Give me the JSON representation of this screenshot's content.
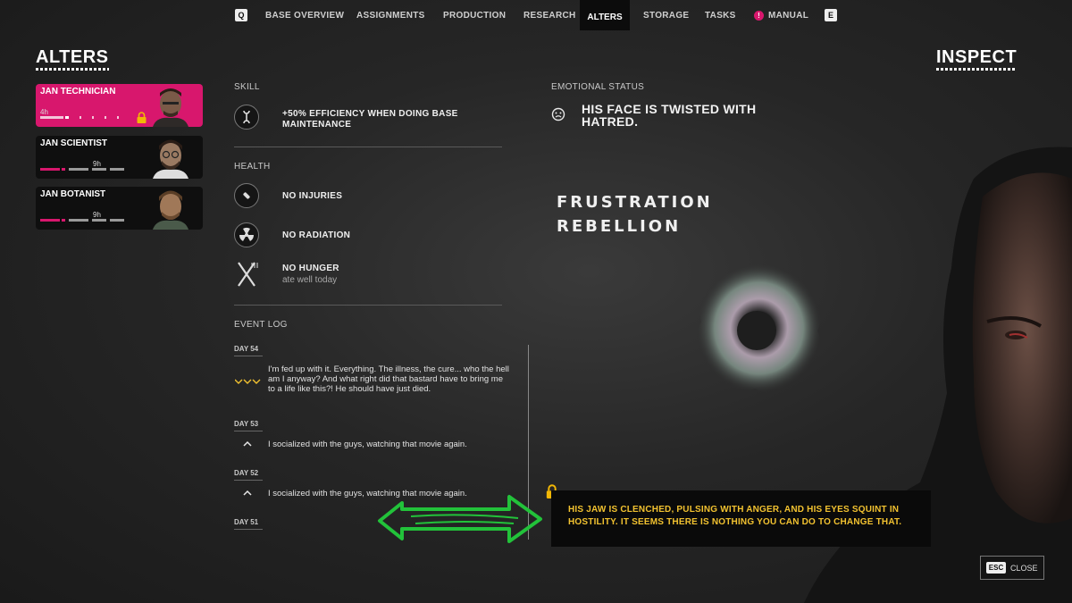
{
  "nav": {
    "key_left": "Q",
    "key_right": "E",
    "items": [
      "BASE OVERVIEW",
      "ASSIGNMENTS",
      "PRODUCTION",
      "RESEARCH",
      "ALTERS",
      "STORAGE",
      "TASKS",
      "MANUAL"
    ],
    "manual_badge": "!"
  },
  "left_title": "ALTERS",
  "right_title": "INSPECT",
  "alters": [
    {
      "name": "JAN TECHNICIAN",
      "hours": "4h",
      "selected": true,
      "locked": true
    },
    {
      "name": "JAN SCIENTIST",
      "hours": "9h",
      "selected": false
    },
    {
      "name": "JAN BOTANIST",
      "hours": "9h",
      "selected": false
    }
  ],
  "skill": {
    "label": "SKILL",
    "text": "+50% EFFICIENCY WHEN DOING BASE MAINTENANCE",
    "icon": "wrench-icon"
  },
  "health": {
    "label": "HEALTH",
    "items": [
      {
        "text": "NO INJURIES",
        "icon": "bandage-icon"
      },
      {
        "text": "NO RADIATION",
        "icon": "radiation-icon"
      },
      {
        "text": "NO HUNGER",
        "sub": "ate well today",
        "icon": "fork-knife-icon"
      }
    ]
  },
  "event_log": {
    "label": "EVENT LOG",
    "entries": [
      {
        "day": "DAY 54",
        "icon": "triple-down-chevron-icon",
        "text": "I'm fed up with it. Everything. The illness, the cure... who the hell am I anyway? And what right did that bastard have to bring me to a life like this?! He should have just died."
      },
      {
        "day": "DAY 53",
        "icon": "up-chevron-icon",
        "text": "I socialized with the guys, watching that movie again."
      },
      {
        "day": "DAY 52",
        "icon": "up-chevron-icon",
        "text": "I socialized with the guys, watching that movie again."
      },
      {
        "day": "DAY 51"
      }
    ]
  },
  "emotional": {
    "label": "EMOTIONAL STATUS",
    "text": "HIS FACE IS TWISTED WITH HATRED.",
    "icon": "frown-face-icon",
    "words": [
      "FRUSTRATION",
      "REBELLION"
    ]
  },
  "tooltip": {
    "text": "HIS JAW IS CLENCHED, PULSING WITH ANGER, AND HIS EYES SQUINT IN HOSTILITY. IT SEEMS THERE IS NOTHING YOU CAN DO TO CHANGE THAT."
  },
  "close": {
    "key": "ESC",
    "label": "CLOSE"
  },
  "colors": {
    "accent": "#d8176d",
    "tooltip_text": "#f2c230",
    "annotation_arrow": "#22c23a",
    "lock": "#f2b705"
  }
}
